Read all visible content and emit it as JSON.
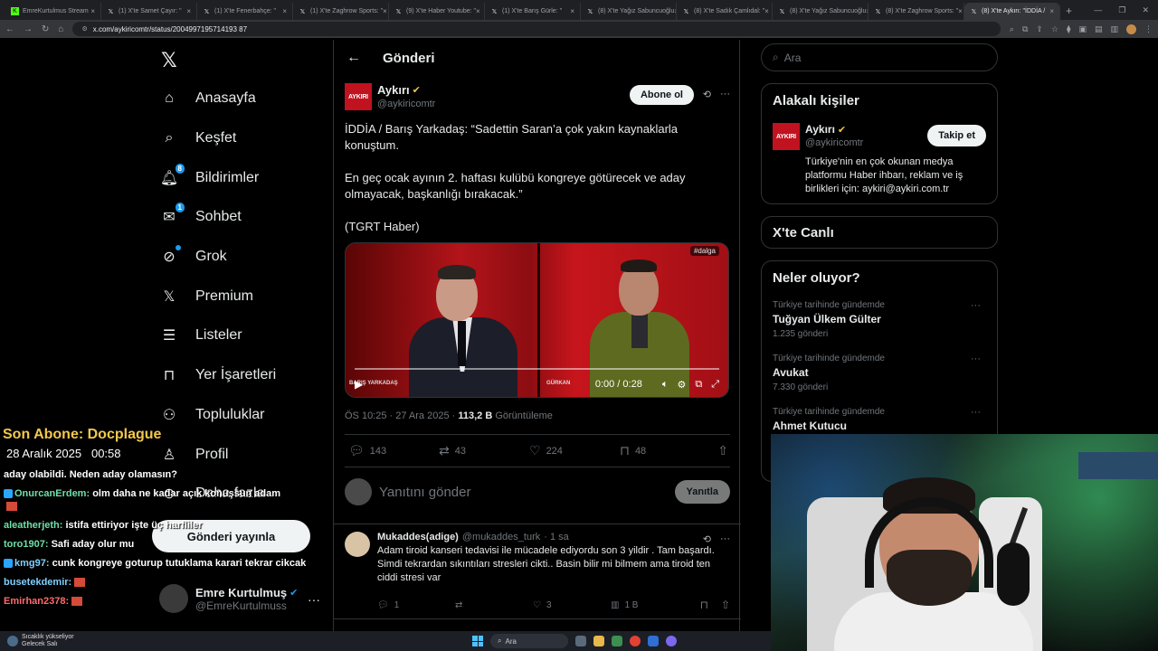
{
  "browser": {
    "tabs": [
      {
        "title": "EmreKurtulmus Stream",
        "icon": "k-icon",
        "icon_color": "#53fc18"
      },
      {
        "title": "(1) X'te Samet Çayır: \"",
        "icon": "x-icon"
      },
      {
        "title": "(1) X'te Fenerbahçe: \"",
        "icon": "x-icon"
      },
      {
        "title": "(1) X'te Zaghrow Sports: \"",
        "icon": "x-icon"
      },
      {
        "title": "(9) X'te Haber Youtube: \"",
        "icon": "x-icon"
      },
      {
        "title": "(1) X'te Barış Gürle: \"",
        "icon": "x-icon"
      },
      {
        "title": "(8) X'te Yağız Sabuncuoğlu",
        "icon": "x-icon"
      },
      {
        "title": "(8) X'te Sadık Çamlıdal: \"",
        "icon": "x-icon"
      },
      {
        "title": "(8) X'te Yağız Sabuncuoğlu",
        "icon": "x-icon"
      },
      {
        "title": "(8) X'te Zaghrow Sports: \"",
        "icon": "x-icon"
      },
      {
        "title": "(8) X'te Aykırı: \"İDDİA /",
        "icon": "x-icon",
        "active": true
      }
    ],
    "url": "x.com/aykiricomtr/status/2004997195714193 87",
    "url_display": "x.com/aykiricomtr/status/2004997195714193​87"
  },
  "nav": {
    "items": [
      {
        "label": "Anasayfa",
        "icon": "home-icon"
      },
      {
        "label": "Keşfet",
        "icon": "search-icon"
      },
      {
        "label": "Bildirimler",
        "icon": "bell-icon",
        "badge": "8"
      },
      {
        "label": "Sohbet",
        "icon": "mail-icon",
        "badge": "1"
      },
      {
        "label": "Grok",
        "icon": "grok-icon"
      },
      {
        "label": "Premium",
        "icon": "x-premium-icon"
      },
      {
        "label": "Listeler",
        "icon": "list-icon"
      },
      {
        "label": "Yer İşaretleri",
        "icon": "bookmark-icon"
      },
      {
        "label": "Topluluklar",
        "icon": "communities-icon"
      },
      {
        "label": "Profil",
        "icon": "profile-icon"
      },
      {
        "label": "Daha fazla",
        "icon": "more-icon"
      }
    ],
    "post_button": "Gönderi yayınla",
    "account": {
      "name": "Emre Kurtulmuş",
      "handle": "@EmreKurtulmuss"
    }
  },
  "main": {
    "header": "Gönderi",
    "tweet": {
      "avatar_text": "AYKIRI",
      "name": "Aykırı",
      "handle": "@aykiricomtr",
      "subscribe": "Abone ol",
      "paragraphs": [
        "İDDİA / Barış Yarkadaş: “Sadettin Saran’a çok yakın kaynaklarla konuştum.",
        "En geç ocak ayının 2. haftası kulübü kongreye götürecek ve aday olmayacak, başkanlığı bırakacak.”",
        "(TGRT Haber)"
      ],
      "video": {
        "tag": "#dalga",
        "time": "0:00 / 0:28",
        "lower_left": "BARIŞ YARKADAŞ",
        "lower_right": "GÜRKAN"
      },
      "meta_time": "ÖS 10:25 · 27 Ara 2025 · ",
      "meta_views": "113,2 B",
      "meta_views_label": " Görüntüleme",
      "replies": "143",
      "reposts": "43",
      "likes": "224",
      "bookmarks": "48"
    },
    "reply_box": {
      "placeholder": "Yanıtını gönder",
      "button": "Yanıtla"
    },
    "comment": {
      "name": "Mukaddes(adige)",
      "handle": "@mukaddes_turk",
      "time": "· 1 sa",
      "text": "Adam tiroid kanseri tedavisi ile mücadele ediyordu son 3 yildir . Tam başardı. Simdi tekrardan sıkıntıları stresleri cikti.. Basin bilir mi bilmem ama tiroid ten ciddi stresi var",
      "replies": "1",
      "likes": "3",
      "views": "1 B"
    }
  },
  "right": {
    "search_placeholder": "Ara",
    "related_title": "Alakalı kişiler",
    "related": {
      "name": "Aykırı",
      "handle": "@aykiricomtr",
      "follow": "Takip et",
      "bio": "Türkiye'nin en çok okunan medya platformu Haber ihbarı, reklam ve iş birlikleri için: aykiri@aykiri.com.tr"
    },
    "live_title": "X'te Canlı",
    "trends_title": "Neler oluyor?",
    "trends": [
      {
        "context": "Türkiye tarihinde gündemde",
        "title": "Tuğyan Ülkem Gülter",
        "count": "1.235 gönderi"
      },
      {
        "context": "Türkiye tarihinde gündemde",
        "title": "Avukat",
        "count": "7.330 gönderi"
      },
      {
        "context": "Türkiye tarihinde gündemde",
        "title": "Ahmet Kutucu",
        "count": ""
      }
    ]
  },
  "overlay": {
    "last_sub": "Son Abone: Docplague",
    "date": "28 Aralık 2025",
    "time": "00:58",
    "chat": [
      {
        "user": "",
        "text": "aday olabildi. Neden aday olamasın?"
      },
      {
        "user": "OnurcanErdem:",
        "text": " olm daha ne kadar açık konuşsun adam"
      },
      {
        "user": "aleatherjeth:",
        "text": " istifa ettiriyor işte üç harfliler"
      },
      {
        "user": "toro1907:",
        "text": " Safi aday olur mu"
      },
      {
        "user": "kmg97:",
        "text": " cunk kongreye goturup tutuklama karari tekrar cikcak"
      },
      {
        "user": "busetekdemir:",
        "text": ""
      },
      {
        "user": "Emirhan2378:",
        "text": ""
      }
    ]
  },
  "taskbar": {
    "weather_line1": "Sıcaklık yükseliyor",
    "weather_line2": "Gelecek Salı",
    "search": "Ara"
  },
  "colors": {
    "accent": "#1d9bf0",
    "verified_gold": "#f4c542",
    "aykiri_red": "#c1121f",
    "overlay_gold": "#f3c84e"
  }
}
